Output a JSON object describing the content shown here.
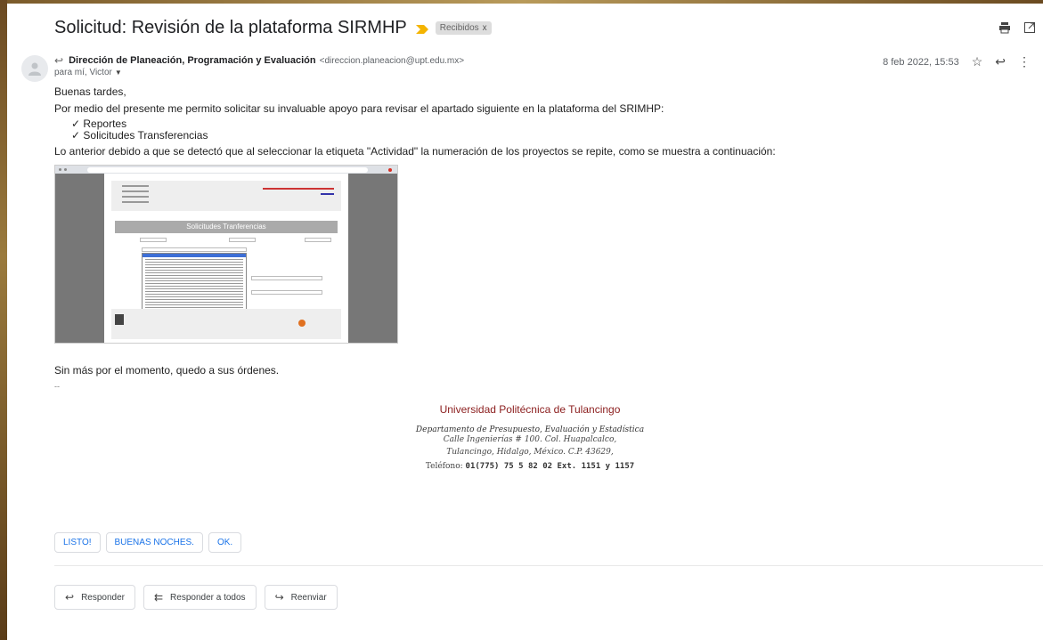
{
  "email": {
    "subject": "Solicitud: Revisión de la plataforma SIRMHP",
    "label": "Recibidos",
    "label_close": "x",
    "sender_name": "Dirección de Planeación, Programación y Evaluación",
    "sender_email": "<direccion.planeacion@upt.edu.mx>",
    "recipients": "para mí, Victor",
    "date": "8 feb 2022, 15:53"
  },
  "icons": {
    "print": "print-icon",
    "popout": "new-window-icon",
    "star": "star-icon",
    "reply": "reply-icon",
    "more": "more-vert-icon"
  },
  "body": {
    "greeting": "Buenas tardes,",
    "intro": "Por medio del presente me permito solicitar su invaluable apoyo para revisar el apartado siguiente en la plataforma del SRIMHP:",
    "items": [
      "Reportes",
      "Solicitudes Transferencias"
    ],
    "explanation": "Lo anterior debido a que se detectó que al seleccionar la etiqueta \"Actividad\" la numeración de los proyectos se repite, como se muestra a continuación:",
    "closing": "Sin más por el momento, quedo a sus órdenes.",
    "separator": "--"
  },
  "screenshot": {
    "panel_title": "Solicitudes Tranferencias"
  },
  "signature": {
    "university": "Universidad Politécnica de Tulancingo",
    "department": "Departamento de Presupuesto, Evaluación y Estadística",
    "address1": "Calle Ingenierías # 100. Col. Huapalcalco,",
    "address2": "Tulancingo, Hidalgo, México. C.P. 43629,",
    "phone_label": "Teléfono:",
    "phone": "01(775) 75 5 82 02 Ext. 1151 y 1157"
  },
  "smart_replies": [
    "LISTO!",
    "BUENAS NOCHES.",
    "OK."
  ],
  "actions": {
    "reply": "Responder",
    "reply_all": "Responder a todos",
    "forward": "Reenviar"
  }
}
